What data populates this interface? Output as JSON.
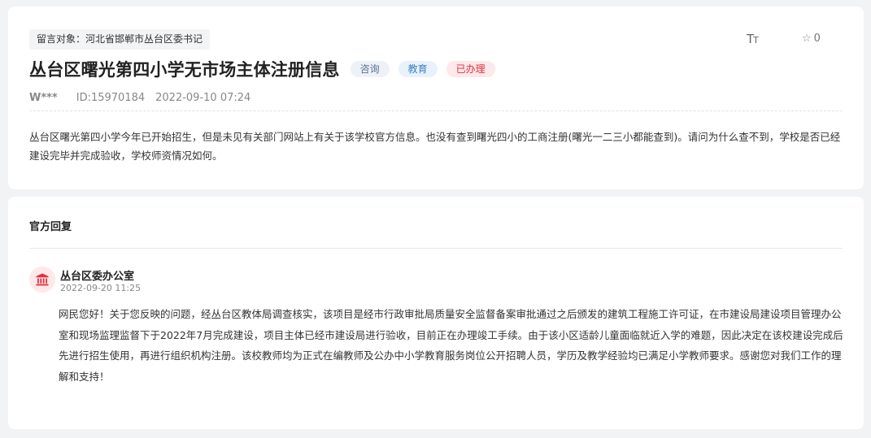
{
  "message": {
    "target": "留言对象：河北省邯郸市丛台区委书记",
    "toolbar": {
      "fontsize_big": "T",
      "fontsize_small": "T",
      "favorite_icon": "star-outline-icon",
      "favorite_count": "0"
    },
    "title": "丛台区曙光第四小学无市场主体注册信息",
    "tags": [
      "咨询",
      "教育",
      "已办理"
    ],
    "user": "W***",
    "id": "ID:15970184",
    "datetime": "2022-09-10 07:24",
    "content": "丛台区曙光第四小学今年已开始招生，但是未见有关部门网站上有关于该学校官方信息。也没有查到曙光四小的工商注册(曙光一二三小都能查到)。请问为什么查不到，学校是否已经建设完毕并完成验收，学校师资情况如何。"
  },
  "reply": {
    "heading": "官方回复",
    "avatar_icon": "government-building-icon",
    "replier": "丛台区委办公室",
    "datetime": "2022-09-20 11:25",
    "content": "网民您好！关于您反映的问题，经丛台区教体局调查核实，该项目是经市行政审批局质量安全监督备案审批通过之后颁发的建筑工程施工许可证，在市建设局建设项目管理办公室和现场监理监督下于2022年7月完成建设，项目主体已经市建设局进行验收，目前正在办理竣工手续。由于该小区适龄儿童面临就近入学的难题，因此决定在该校建设完成后先进行招生使用，再进行组织机构注册。该校教师均为正式在编教师及公办中小学教育服务岗位公开招聘人员，学历及教学经验均已满足小学教师要求。感谢您对我们工作的理解和支持！"
  },
  "colors": {
    "page_bg": "#f2f3f5",
    "tag_done": "#e0303f",
    "tag_edu": "#3b7fc4",
    "avatar_icon": "#e0303f"
  }
}
